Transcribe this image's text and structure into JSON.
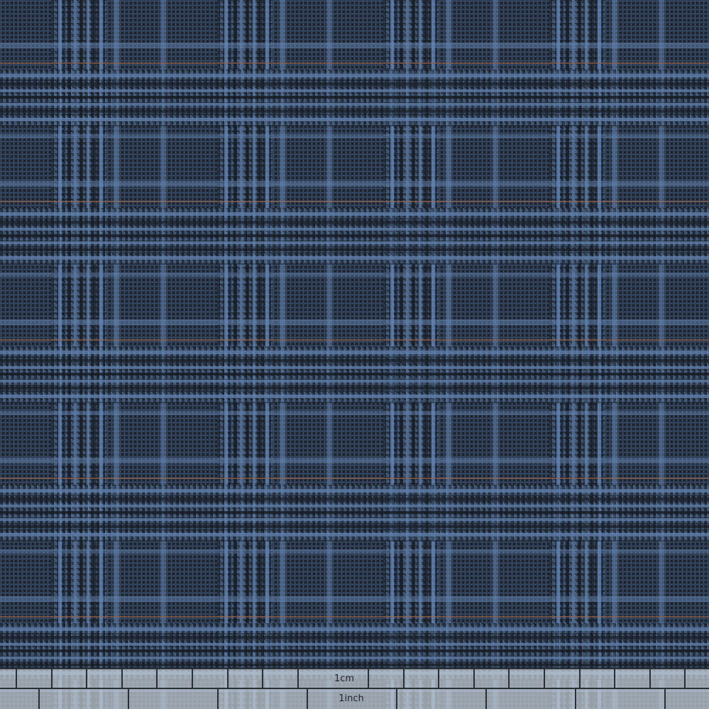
{
  "ruler": {
    "cm_label": "1cm",
    "inch_label": "1inch"
  },
  "colors": {
    "ground_navy": "#2c3848",
    "thread_blue": "#6f93c4",
    "thread_black": "#15191f",
    "overcheck_rust": "#b2714f",
    "ruler_bg": "#c6ced6",
    "ruler_line": "#2a2f36"
  }
}
